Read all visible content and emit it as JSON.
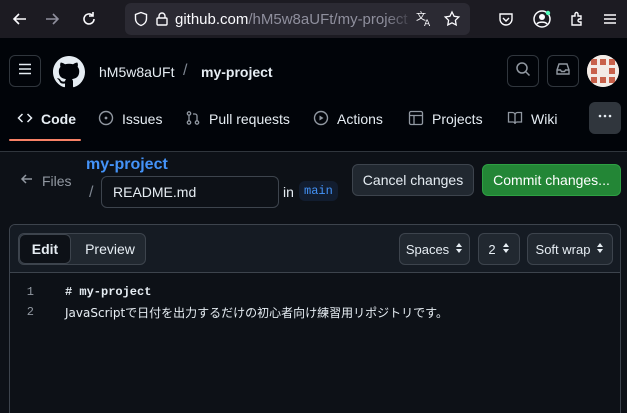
{
  "browser": {
    "url_host": "github.com",
    "url_path": "/hM5w8aUFt/my-project",
    "toolbar_icons": [
      "back-arrow-icon",
      "forward-arrow-icon",
      "reload-icon",
      "shield-icon",
      "lock-icon",
      "translate-icon",
      "bookmark-star-icon",
      "pocket-icon",
      "account-icon",
      "extensions-icon",
      "menu-icon"
    ]
  },
  "header": {
    "owner": "hM5w8aUFt",
    "separator": "/",
    "repo": "my-project"
  },
  "tabs": [
    {
      "label": "Code",
      "icon": "code-icon",
      "active": true
    },
    {
      "label": "Issues",
      "icon": "issue-icon",
      "active": false
    },
    {
      "label": "Pull requests",
      "icon": "pull-request-icon",
      "active": false
    },
    {
      "label": "Actions",
      "icon": "play-icon",
      "active": false
    },
    {
      "label": "Projects",
      "icon": "table-icon",
      "active": false
    },
    {
      "label": "Wiki",
      "icon": "book-icon",
      "active": false
    }
  ],
  "editor_header": {
    "files_label": "Files",
    "repo_link": "my-project",
    "path_sep": "/",
    "filename": "README.md",
    "in_label": "in",
    "branch": "main",
    "cancel_label": "Cancel changes",
    "commit_label": "Commit changes..."
  },
  "editor": {
    "edit_tab": "Edit",
    "preview_tab": "Preview",
    "indent_mode": "Spaces",
    "indent_size": "2",
    "wrap_mode": "Soft wrap",
    "lines": [
      {
        "number": "1",
        "text": "# my-project"
      },
      {
        "number": "2",
        "text": "JavaScriptで日付を出力するだけの初心者向け練習用リポジトリです。"
      }
    ]
  },
  "colors": {
    "accent_link": "#4493f8",
    "commit_green": "#238636",
    "tab_underline": "#f78166"
  }
}
